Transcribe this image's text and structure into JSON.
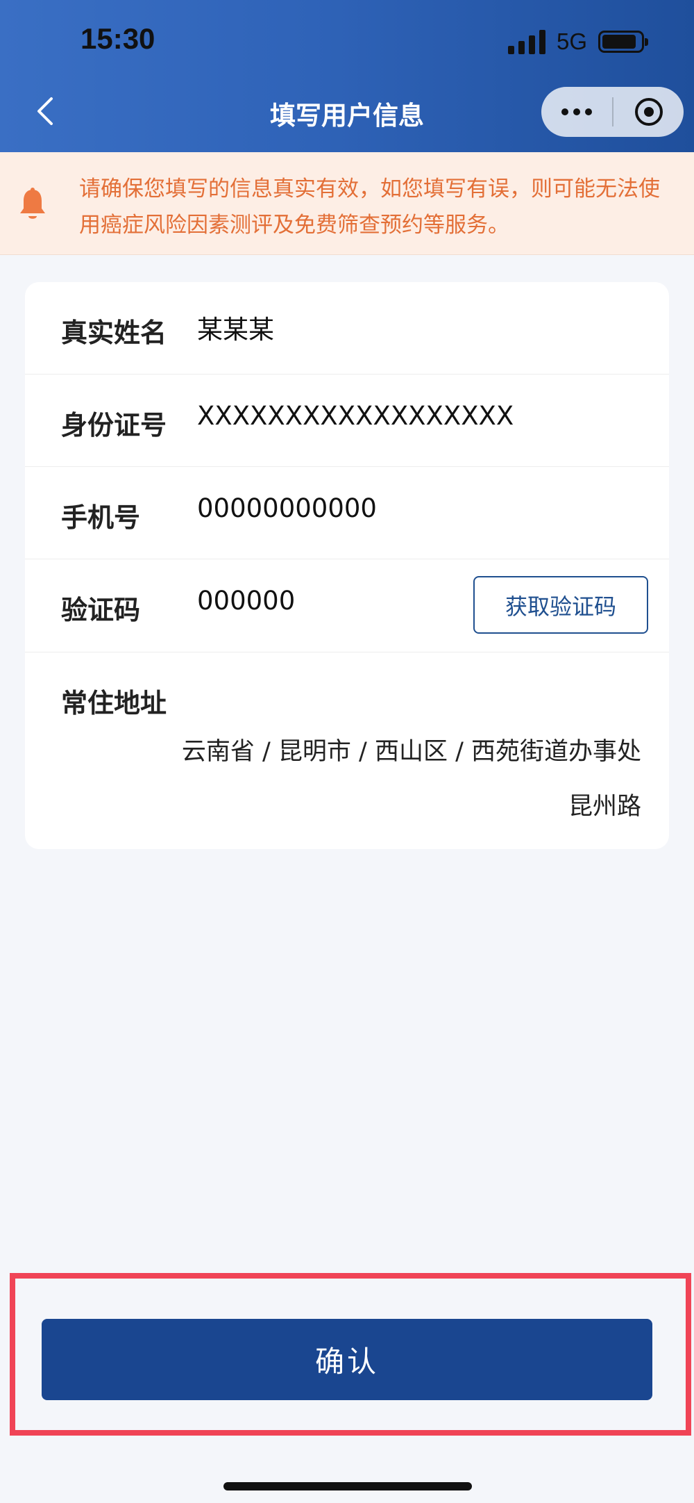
{
  "status_bar": {
    "time": "15:30",
    "network": "5G"
  },
  "nav": {
    "title": "填写用户信息"
  },
  "notice": {
    "text": "请确保您填写的信息真实有效，如您填写有误，则可能无法使用癌症风险因素测评及免费筛查预约等服务。"
  },
  "form": {
    "name": {
      "label": "真实姓名",
      "value": "某某某"
    },
    "id_card": {
      "label": "身份证号",
      "value": "XXXXXXXXXXXXXXXXXX"
    },
    "phone": {
      "label": "手机号",
      "value": "00000000000"
    },
    "code": {
      "label": "验证码",
      "value": "000000",
      "button": "获取验证码"
    },
    "address": {
      "label": "常住地址",
      "region": "云南省 / 昆明市 / 西山区 / 西苑街道办事处",
      "detail": "昆州路"
    }
  },
  "footer": {
    "confirm_label": "确认"
  },
  "colors": {
    "header": "#2f63b8",
    "notice_text": "#e36f37",
    "primary_button": "#1a4690",
    "highlight_frame": "#f04456"
  }
}
